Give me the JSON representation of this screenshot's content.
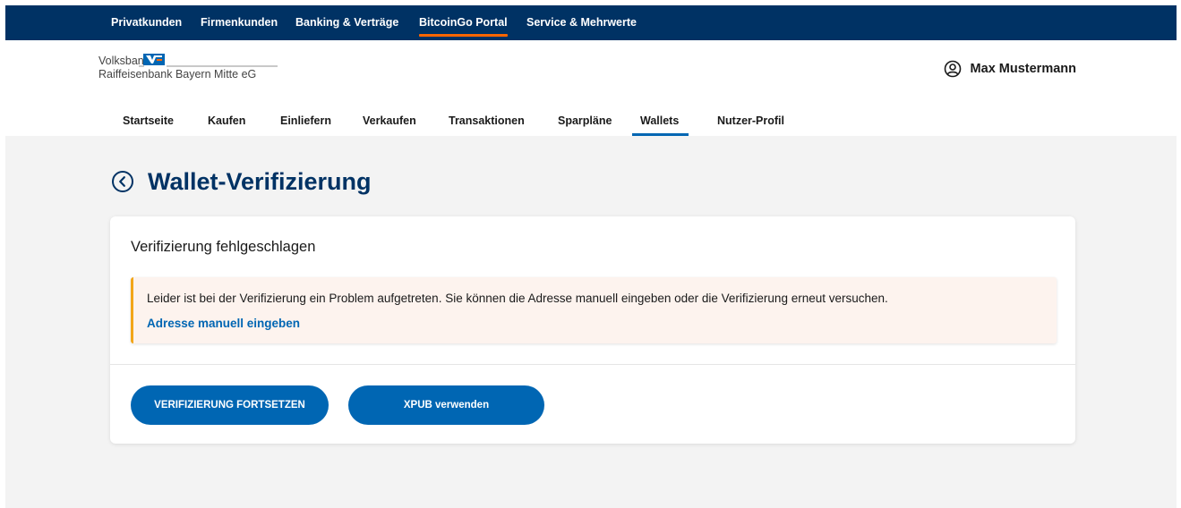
{
  "top_nav": {
    "items": [
      {
        "label": "Privatkunden"
      },
      {
        "label": "Firmenkunden"
      },
      {
        "label": "Banking & Verträge"
      },
      {
        "label": "BitcoinGo Portal",
        "active": true
      },
      {
        "label": "Service & Mehrwerte"
      }
    ],
    "accent_color": "#ff6600",
    "background_color": "#003264"
  },
  "brand": {
    "line1": "Volksbank",
    "line2": "Raiffeisenbank Bayern Mitte eG"
  },
  "user": {
    "name": "Max Mustermann",
    "icon": "user-circle-icon"
  },
  "sub_nav": {
    "items": [
      {
        "label": "Startseite"
      },
      {
        "label": "Kaufen"
      },
      {
        "label": "Einliefern"
      },
      {
        "label": "Verkaufen"
      },
      {
        "label": "Transaktionen"
      },
      {
        "label": "Sparpläne"
      },
      {
        "label": "Wallets",
        "active": true
      },
      {
        "label": "Nutzer-Profil"
      }
    ]
  },
  "page": {
    "title": "Wallet-Verifizierung",
    "back_icon": "chevron-left-circle-icon"
  },
  "card": {
    "title": "Verifizierung fehlgeschlagen",
    "alert": {
      "message": "Leider ist bei der Verifizierung ein Problem aufgetreten. Sie können die Adresse manuell eingeben oder die Verifizierung erneut versuchen.",
      "link": "Adresse manuell eingeben",
      "accent_color": "#f2a61a"
    },
    "buttons": {
      "primary": "VERIFIZIERUNG FORTSETZEN",
      "secondary": "XPUB verwenden"
    }
  },
  "colors": {
    "brand_blue": "#003264",
    "action_blue": "#0066b3",
    "page_background": "#f3f3f3"
  }
}
